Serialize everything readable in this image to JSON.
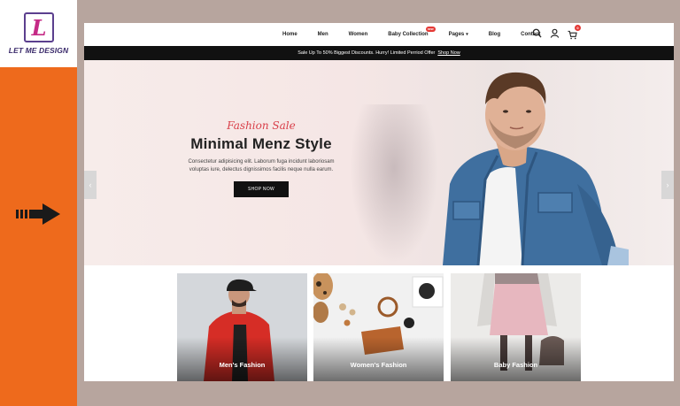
{
  "brand": {
    "logo_letter": "L",
    "logo_text": "LET ME DESIGN"
  },
  "nav": {
    "items": [
      "Home",
      "Men",
      "Women",
      "Baby Collection",
      "Pages",
      "Blog",
      "Contact"
    ],
    "badge": "new",
    "cart_count": "0"
  },
  "promo": {
    "text": "Sale Up To 50% Biggest Discounts. Hurry! Limited Perriod Offer",
    "link": "Shop Now"
  },
  "hero": {
    "subtitle": "Fashion Sale",
    "title": "Minimal Menz Style",
    "description": "Consectetur adipisicing elit. Laborum fuga incidunt laboriosam voluptas iure, delectus dignissimos facilis neque nulla earum.",
    "button": "SHOP NOW"
  },
  "categories": [
    {
      "label": "Men's Fashion"
    },
    {
      "label": "Women's Fashion"
    },
    {
      "label": "Baby Fashion"
    }
  ],
  "colors": {
    "accent": "#ee6a1c",
    "sale_red": "#d9404a",
    "dark": "#111111"
  }
}
